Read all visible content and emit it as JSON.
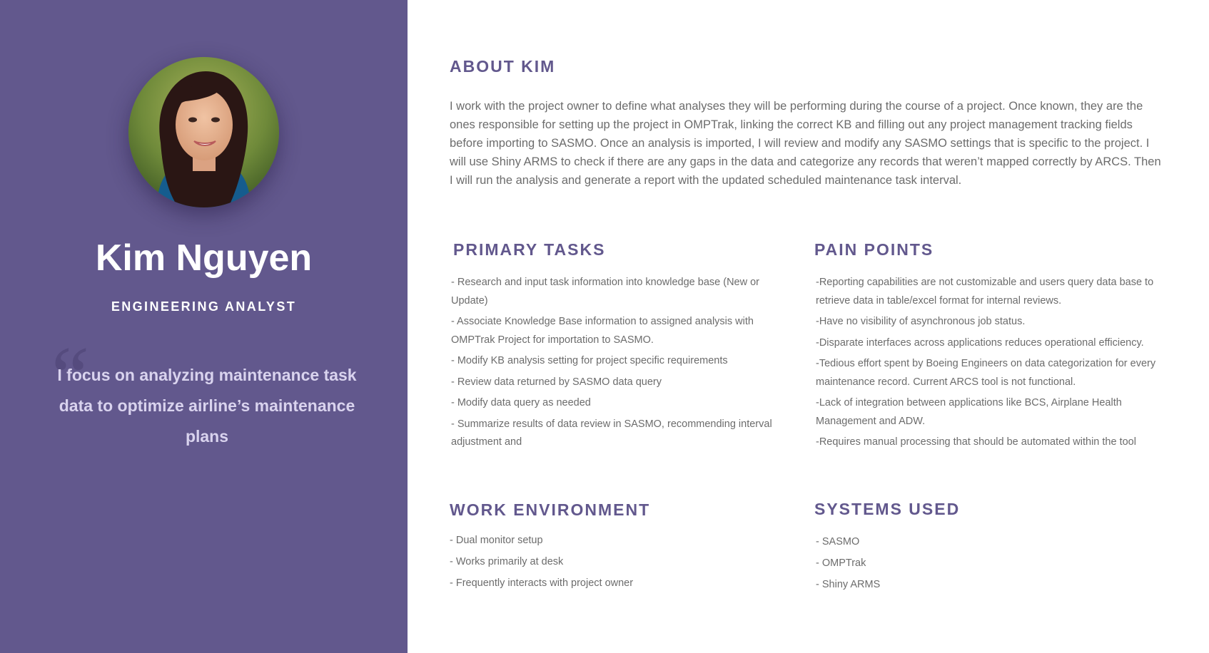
{
  "profile": {
    "name": "Kim Nguyen",
    "role": "ENGINEERING ANALYST",
    "quote_mark": "“",
    "quote": "I focus on analyzing maintenance task data to optimize airline’s maintenance plans"
  },
  "about": {
    "heading": "ABOUT KIM",
    "text": "I work with the project owner to define what analyses they will be performing during the course of a project. Once known, they are the ones responsible for setting up the project in OMPTrak, linking the correct KB and filling out any project management tracking fields before importing to SASMO.  Once an analysis is imported, I will review and modify any SASMO settings that is specific to the project.  I will use Shiny ARMS to check if there are any gaps in the data and categorize any records that weren’t mapped correctly by ARCS. Then I will run the analysis and generate a report with the updated scheduled maintenance task interval."
  },
  "primary_tasks": {
    "heading": "PRIMARY TASKS",
    "items": [
      "- Research and input task information into knowledge base (New or Update)",
      "- Associate Knowledge Base information to assigned analysis with OMPTrak Project for importation to SASMO.",
      "- Modify KB analysis setting for project specific requirements",
      "- Review data returned by SASMO data query",
      "- Modify data query as needed",
      "- Summarize results of data review in SASMO, recommending interval adjustment and"
    ]
  },
  "pain_points": {
    "heading": "PAIN POINTS",
    "items": [
      "-Reporting capabilities are not customizable and users query data base to retrieve data in table/excel format for internal reviews.",
      "-Have no visibility of asynchronous job status.",
      "-Disparate interfaces across applications reduces operational efficiency.",
      "-Tedious effort spent by Boeing Engineers on data categorization for every maintenance record. Current ARCS tool is not functional.",
      "-Lack of integration between applications like BCS, Airplane Health Management and ADW.",
      "-Requires manual processing that should be automated within the tool"
    ]
  },
  "work_environment": {
    "heading": "WORK ENVIRONMENT",
    "items": [
      "- Dual monitor setup",
      "- Works primarily at desk",
      "- Frequently interacts with project owner"
    ]
  },
  "systems_used": {
    "heading": "SYSTEMS USED",
    "items": [
      "- SASMO",
      "- OMPTrak",
      "- Shiny ARMS"
    ]
  },
  "colors": {
    "panel": "#62588d",
    "heading": "#62588d",
    "body_text": "#6c6c6c"
  }
}
